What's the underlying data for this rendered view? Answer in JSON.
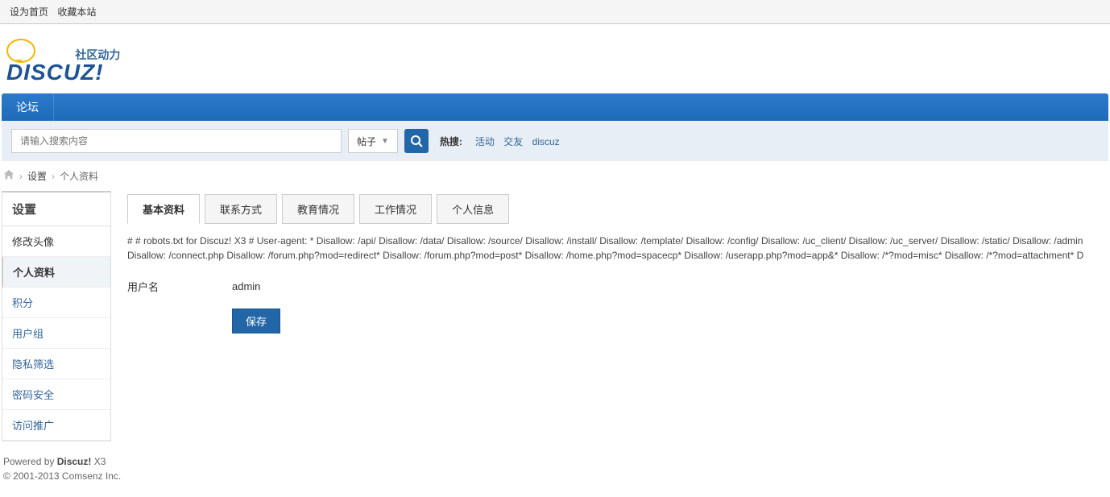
{
  "topbar": {
    "set_home": "设为首页",
    "favorite": "收藏本站"
  },
  "logo": {
    "cn": "社区动力",
    "main": "DISCUZ!"
  },
  "navbar": {
    "forum": "论坛"
  },
  "search": {
    "placeholder": "请输入搜索内容",
    "type": "帖子",
    "hot_label": "热搜:",
    "hot_links": [
      "活动",
      "交友",
      "discuz"
    ]
  },
  "breadcrumb": {
    "settings": "设置",
    "profile": "个人资料"
  },
  "sidebar": {
    "title": "设置",
    "items": [
      {
        "label": "修改头像",
        "blue": false
      },
      {
        "label": "个人资料",
        "blue": false,
        "active": true
      },
      {
        "label": "积分",
        "blue": true
      },
      {
        "label": "用户组",
        "blue": true
      },
      {
        "label": "隐私筛选",
        "blue": true
      },
      {
        "label": "密码安全",
        "blue": true
      },
      {
        "label": "访问推广",
        "blue": true
      }
    ]
  },
  "tabs": [
    {
      "label": "基本资料",
      "active": true
    },
    {
      "label": "联系方式"
    },
    {
      "label": "教育情况"
    },
    {
      "label": "工作情况"
    },
    {
      "label": "个人信息"
    }
  ],
  "robots_text": "# # robots.txt for Discuz! X3 # User-agent: * Disallow: /api/ Disallow: /data/ Disallow: /source/ Disallow: /install/ Disallow: /template/ Disallow: /config/ Disallow: /uc_client/ Disallow: /uc_server/ Disallow: /static/ Disallow: /admin Disallow: /connect.php Disallow: /forum.php?mod=redirect* Disallow: /forum.php?mod=post* Disallow: /home.php?mod=spacecp* Disallow: /userapp.php?mod=app&* Disallow: /*?mod=misc* Disallow: /*?mod=attachment* D",
  "form": {
    "username_label": "用户名",
    "username_value": "admin",
    "save": "保存"
  },
  "footer": {
    "powered": "Powered by ",
    "brand": "Discuz!",
    "version": " X3",
    "copyright": "© 2001-2013 Comsenz Inc."
  }
}
